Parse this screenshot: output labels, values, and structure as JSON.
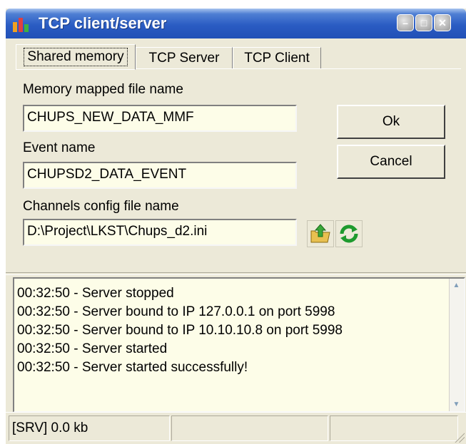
{
  "window": {
    "title": "TCP client/server"
  },
  "icons": {
    "app": "chart-app-icon",
    "open": "open-folder-icon",
    "reload": "refresh-icon"
  },
  "colors": {
    "titlebar": "#2a5cc3",
    "field_bg": "#fdfde8",
    "window_bg": "#ece9d8"
  },
  "tabs": [
    {
      "label": "Shared memory",
      "active": true
    },
    {
      "label": "TCP Server",
      "active": false
    },
    {
      "label": "TCP Client",
      "active": false
    }
  ],
  "form": {
    "mmf_label": "Memory mapped file name",
    "mmf_value": "CHUPS_NEW_DATA_MMF",
    "event_label": "Event name",
    "event_value": "CHUPSD2_DATA_EVENT",
    "config_label": "Channels config file name",
    "config_value": "D:\\Project\\LKST\\Chups_d2.ini"
  },
  "buttons": {
    "ok": "Ok",
    "cancel": "Cancel"
  },
  "log": [
    "00:32:50 - Server stopped",
    "00:32:50 - Server bound to IP 127.0.0.1 on port 5998",
    "00:32:50 - Server bound to IP 10.10.10.8 on port 5998",
    "00:32:50 - Server started",
    "00:32:50 - Server started successfully!"
  ],
  "status": {
    "left": "[SRV] 0.0 kb",
    "middle": "",
    "right": ""
  }
}
